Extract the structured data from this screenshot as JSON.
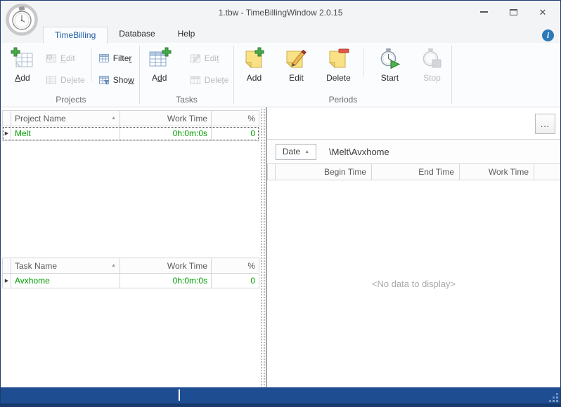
{
  "window": {
    "title": "1.tbw - TimeBillingWindow 2.0.15"
  },
  "tabs": {
    "timebilling": "TimeBilling",
    "database": "Database",
    "help": "Help"
  },
  "icons": {
    "close": "✕",
    "info": "i",
    "sort_asc": "▲",
    "row_marker": "▶"
  },
  "ribbon": {
    "projects": {
      "label": "Projects",
      "add": {
        "pre": "",
        "mn": "A",
        "post": "dd"
      },
      "edit": {
        "pre": "",
        "mn": "E",
        "post": "dit"
      },
      "delete": {
        "pre": "De",
        "mn": "l",
        "post": "ete"
      },
      "filter": {
        "pre": "Filte",
        "mn": "r",
        "post": ""
      },
      "show": {
        "pre": "Sho",
        "mn": "w",
        "post": ""
      }
    },
    "tasks": {
      "label": "Tasks",
      "add": {
        "pre": "A",
        "mn": "d",
        "post": "d"
      },
      "edit": {
        "pre": "Edi",
        "mn": "t",
        "post": ""
      },
      "delete": {
        "pre": "Dele",
        "mn": "t",
        "post": "e"
      }
    },
    "periods": {
      "label": "Periods",
      "add": "Add",
      "edit": "Edit",
      "delete": "Delete",
      "start": "Start",
      "stop": "Stop"
    }
  },
  "projects_grid": {
    "columns": {
      "name": "Project Name",
      "work_time": "Work Time",
      "percent": "%"
    },
    "rows": [
      {
        "name": "Melt",
        "work_time": "0h:0m:0s",
        "percent": "0"
      }
    ]
  },
  "tasks_grid": {
    "columns": {
      "name": "Task Name",
      "work_time": "Work Time",
      "percent": "%"
    },
    "rows": [
      {
        "name": "Avxhome",
        "work_time": "0h:0m:0s",
        "percent": "0"
      }
    ]
  },
  "periods_panel": {
    "more_button": "...",
    "group_field": "Date",
    "path": "\\Melt\\Avxhome",
    "columns": {
      "begin": "Begin Time",
      "end": "End Time",
      "work": "Work Time"
    },
    "empty_text": "<No data to display>"
  },
  "colors": {
    "accent_blue": "#1f5da8",
    "status_bar_blue": "#1e4e91",
    "data_green": "#00a000",
    "disabled_text": "#b9bdc2"
  }
}
